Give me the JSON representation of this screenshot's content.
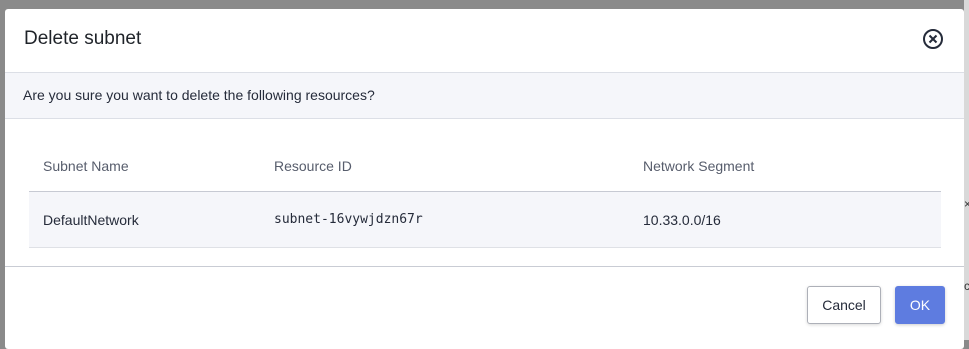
{
  "dialog": {
    "title": "Delete subnet",
    "close_icon": "close-circle-icon",
    "confirm_message": "Are you sure you want to delete the following resources?",
    "table": {
      "columns": [
        "Subnet Name",
        "Resource ID",
        "Network Segment"
      ],
      "rows": [
        [
          "DefaultNetwork",
          "subnet-16vywjdzn67r",
          "10.33.0.0/16"
        ]
      ]
    },
    "buttons": {
      "cancel": "Cancel",
      "ok": "OK"
    },
    "colors": {
      "primary": "#5e7ce0",
      "overlay": "#8a8a8a"
    }
  },
  "backdrop": {
    "glyph_top": "×",
    "glyph_bottom": "c"
  }
}
